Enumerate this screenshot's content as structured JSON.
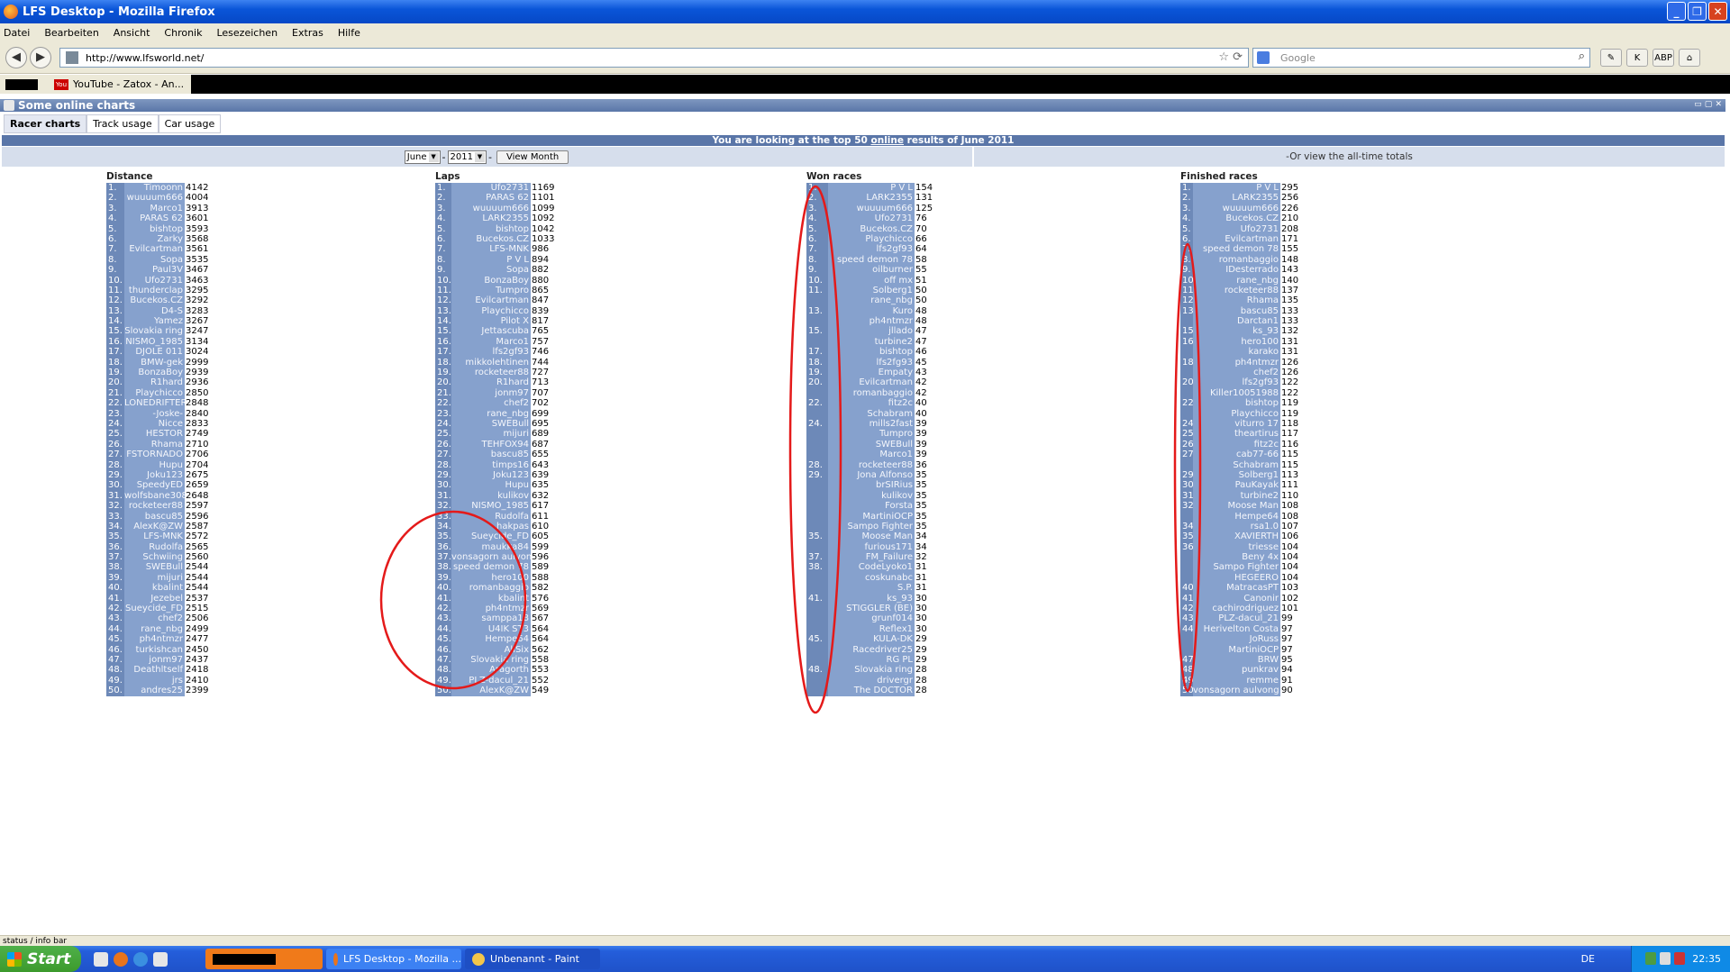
{
  "window": {
    "title": "LFS Desktop - Mozilla Firefox",
    "buttons": [
      "_",
      "❐",
      "✕"
    ]
  },
  "menu": [
    "Datei",
    "Bearbeiten",
    "Ansicht",
    "Chronik",
    "Lesezeichen",
    "Extras",
    "Hilfe"
  ],
  "nav": {
    "url": "http://www.lfsworld.net/",
    "search_placeholder": "Google"
  },
  "bookmarks": {
    "youtube": "YouTube - Zatox - An...",
    "yt_icon": "You"
  },
  "panel": {
    "title": "Some online charts"
  },
  "tabs": [
    "Racer charts",
    "Track usage",
    "Car usage"
  ],
  "banner": {
    "pre": "You are looking at the top 50 ",
    "link": "online",
    "post": " results of June 2011"
  },
  "controls": {
    "month": "June",
    "year": "2011",
    "sep": "-",
    "view_button": "View Month",
    "alltime": "-Or view the all-time totals"
  },
  "columns": [
    {
      "title": "Distance",
      "rows": [
        [
          "1.",
          "Timoonn",
          "4142"
        ],
        [
          "2.",
          "wuuuum666",
          "4004"
        ],
        [
          "3.",
          "Marco1",
          "3913"
        ],
        [
          "4.",
          "PARAS 62",
          "3601"
        ],
        [
          "5.",
          "bishtop",
          "3593"
        ],
        [
          "6.",
          "Zarky",
          "3568"
        ],
        [
          "7.",
          "Evilcartman",
          "3561"
        ],
        [
          "8.",
          "Sopa",
          "3535"
        ],
        [
          "9.",
          "Paul3V",
          "3467"
        ],
        [
          "10.",
          "Ufo2731",
          "3463"
        ],
        [
          "11.",
          "thunderclap",
          "3295"
        ],
        [
          "12.",
          "Bucekos.CZ",
          "3292"
        ],
        [
          "13.",
          "D4-S",
          "3283"
        ],
        [
          "14.",
          "Yamez",
          "3267"
        ],
        [
          "15.",
          "Slovakia ring",
          "3247"
        ],
        [
          "16.",
          "NISMO_1985",
          "3134"
        ],
        [
          "17.",
          "DJOLE 011",
          "3024"
        ],
        [
          "18.",
          "BMW-gek",
          "2999"
        ],
        [
          "19.",
          "BonzaBoy",
          "2939"
        ],
        [
          "20.",
          "R1hard",
          "2936"
        ],
        [
          "21.",
          "Playchicco",
          "2850"
        ],
        [
          "22.",
          "LONEDRIFTER",
          "2848"
        ],
        [
          "23.",
          "-Joske-",
          "2840"
        ],
        [
          "24.",
          "Nicce",
          "2833"
        ],
        [
          "25.",
          "HESTOR",
          "2749"
        ],
        [
          "26.",
          "Rhama",
          "2710"
        ],
        [
          "27.",
          "FSTORNADO",
          "2706"
        ],
        [
          "28.",
          "Hupu",
          "2704"
        ],
        [
          "29.",
          "Joku123",
          "2675"
        ],
        [
          "30.",
          "SpeedyED",
          "2659"
        ],
        [
          "31.",
          "wolfsbane3088",
          "2648"
        ],
        [
          "32.",
          "rocketeer88",
          "2597"
        ],
        [
          "33.",
          "bascu85",
          "2596"
        ],
        [
          "34.",
          "AlexK@ZW",
          "2587"
        ],
        [
          "35.",
          "LFS-MNK",
          "2572"
        ],
        [
          "36.",
          "Rudolfa",
          "2565"
        ],
        [
          "37.",
          "Schwiing",
          "2560"
        ],
        [
          "38.",
          "SWEBull",
          "2544"
        ],
        [
          "39.",
          "mijuri",
          "2544"
        ],
        [
          "40.",
          "kbalint",
          "2544"
        ],
        [
          "41.",
          "Jezebel",
          "2537"
        ],
        [
          "42.",
          "Sueycide_FD",
          "2515"
        ],
        [
          "43.",
          "chef2",
          "2506"
        ],
        [
          "44.",
          "rane_nbg",
          "2499"
        ],
        [
          "45.",
          "ph4ntmzr",
          "2477"
        ],
        [
          "46.",
          "turkishcan",
          "2450"
        ],
        [
          "47.",
          "jonm97",
          "2437"
        ],
        [
          "48.",
          "Deathltself",
          "2418"
        ],
        [
          "49.",
          "jrs",
          "2410"
        ],
        [
          "50.",
          "andres25",
          "2399"
        ]
      ]
    },
    {
      "title": "Laps",
      "rows": [
        [
          "1.",
          "Ufo2731",
          "1169"
        ],
        [
          "2.",
          "PARAS 62",
          "1101"
        ],
        [
          "3.",
          "wuuuum666",
          "1099"
        ],
        [
          "4.",
          "LARK2355",
          "1092"
        ],
        [
          "5.",
          "bishtop",
          "1042"
        ],
        [
          "6.",
          "Bucekos.CZ",
          "1033"
        ],
        [
          "7.",
          "LFS-MNK",
          "986"
        ],
        [
          "8.",
          "P V L",
          "894"
        ],
        [
          "9.",
          "Sopa",
          "882"
        ],
        [
          "10.",
          "BonzaBoy",
          "880"
        ],
        [
          "11.",
          "Tumpro",
          "865"
        ],
        [
          "12.",
          "Evilcartman",
          "847"
        ],
        [
          "13.",
          "Playchicco",
          "839"
        ],
        [
          "14.",
          "Pilot X",
          "817"
        ],
        [
          "15.",
          "Jettascuba",
          "765"
        ],
        [
          "16.",
          "Marco1",
          "757"
        ],
        [
          "17.",
          "lfs2gf93",
          "746"
        ],
        [
          "18.",
          "mikkolehtinen",
          "744"
        ],
        [
          "19.",
          "rocketeer88",
          "727"
        ],
        [
          "20.",
          "R1hard",
          "713"
        ],
        [
          "21.",
          "jonm97",
          "707"
        ],
        [
          "22.",
          "chef2",
          "702"
        ],
        [
          "23.",
          "rane_nbg",
          "699"
        ],
        [
          "24.",
          "SWEBull",
          "695"
        ],
        [
          "25.",
          "mijuri",
          "689"
        ],
        [
          "26.",
          "TEHFOX94",
          "687"
        ],
        [
          "27.",
          "bascu85",
          "655"
        ],
        [
          "28.",
          "timps16",
          "643"
        ],
        [
          "29.",
          "Joku123",
          "639"
        ],
        [
          "30.",
          "Hupu",
          "635"
        ],
        [
          "31.",
          "kulikov",
          "632"
        ],
        [
          "32.",
          "NISMO_1985",
          "617"
        ],
        [
          "33.",
          "Rudolfa",
          "611"
        ],
        [
          "34.",
          "hakpas",
          "610"
        ],
        [
          "35.",
          "Sueycide_FD",
          "605"
        ],
        [
          "36.",
          "maukka84",
          "599"
        ],
        [
          "37.",
          "vonsagorn aulvong",
          "596"
        ],
        [
          "38.",
          "speed demon 78",
          "589"
        ],
        [
          "39.",
          "hero100",
          "588"
        ],
        [
          "40.",
          "romanbaggio",
          "582"
        ],
        [
          "41.",
          "kbalint",
          "576"
        ],
        [
          "42.",
          "ph4ntmzr",
          "569"
        ],
        [
          "43.",
          "samppa18",
          "567"
        ],
        [
          "44.",
          "U4IK ST3",
          "564"
        ],
        [
          "45.",
          "Hempe64",
          "564"
        ],
        [
          "46.",
          "AllSix",
          "562"
        ],
        [
          "47.",
          "Slovakia ring",
          "558"
        ],
        [
          "48.",
          "Aragorth",
          "553"
        ],
        [
          "49.",
          "PLZ-dacul_21",
          "552"
        ],
        [
          "50.",
          "AlexK@ZW",
          "549"
        ]
      ]
    },
    {
      "title": "Won races",
      "rows": [
        [
          "1.",
          "P V L",
          "154"
        ],
        [
          "2.",
          "LARK2355",
          "131"
        ],
        [
          "3.",
          "wuuuum666",
          "125"
        ],
        [
          "4.",
          "Ufo2731",
          "76"
        ],
        [
          "5.",
          "Bucekos.CZ",
          "70"
        ],
        [
          "6.",
          "Playchicco",
          "66"
        ],
        [
          "7.",
          "lfs2gf93",
          "64"
        ],
        [
          "8.",
          "speed demon 78",
          "58"
        ],
        [
          "9.",
          "oilburner",
          "55"
        ],
        [
          "10.",
          "off mx",
          "51"
        ],
        [
          "11.",
          "Solberg1",
          "50"
        ],
        [
          "",
          "rane_nbg",
          "50"
        ],
        [
          "13.",
          "Kuro",
          "48"
        ],
        [
          "",
          "ph4ntmzr",
          "48"
        ],
        [
          "15.",
          "jllado",
          "47"
        ],
        [
          "",
          "turbine2",
          "47"
        ],
        [
          "17.",
          "bishtop",
          "46"
        ],
        [
          "18.",
          "lfs2fg93",
          "45"
        ],
        [
          "19.",
          "Empaty",
          "43"
        ],
        [
          "20.",
          "Evilcartman",
          "42"
        ],
        [
          "",
          "romanbaggio",
          "42"
        ],
        [
          "22.",
          "fitz2c",
          "40"
        ],
        [
          "",
          "Schabram",
          "40"
        ],
        [
          "24.",
          "mills2fast",
          "39"
        ],
        [
          "",
          "Tumpro",
          "39"
        ],
        [
          "",
          "SWEBull",
          "39"
        ],
        [
          "",
          "Marco1",
          "39"
        ],
        [
          "28.",
          "rocketeer88",
          "36"
        ],
        [
          "29.",
          "Jona Alfonso",
          "35"
        ],
        [
          "",
          "brSIRius",
          "35"
        ],
        [
          "",
          "kulikov",
          "35"
        ],
        [
          "",
          "Forsta",
          "35"
        ],
        [
          "",
          "MartiniOCP",
          "35"
        ],
        [
          "",
          "Sampo Fighter",
          "35"
        ],
        [
          "35.",
          "Moose Man",
          "34"
        ],
        [
          "",
          "furious171",
          "34"
        ],
        [
          "37.",
          "FM_Failure",
          "32"
        ],
        [
          "38.",
          "CodeLyoko1",
          "31"
        ],
        [
          "",
          "coskunabc",
          "31"
        ],
        [
          "",
          "S.P.",
          "31"
        ],
        [
          "41.",
          "ks_93",
          "30"
        ],
        [
          "",
          "STIGGLER (BE)",
          "30"
        ],
        [
          "",
          "grunf014",
          "30"
        ],
        [
          "",
          "Reflex1",
          "30"
        ],
        [
          "45.",
          "KULA-DK",
          "29"
        ],
        [
          "",
          "Racedriver25",
          "29"
        ],
        [
          "",
          "RG PL",
          "29"
        ],
        [
          "48.",
          "Slovakia ring",
          "28"
        ],
        [
          "",
          "drivergr",
          "28"
        ],
        [
          "",
          "The DOCTOR",
          "28"
        ]
      ]
    },
    {
      "title": "Finished races",
      "rows": [
        [
          "1.",
          "P V L",
          "295"
        ],
        [
          "2.",
          "LARK2355",
          "256"
        ],
        [
          "3.",
          "wuuuum666",
          "226"
        ],
        [
          "4.",
          "Bucekos.CZ",
          "210"
        ],
        [
          "5.",
          "Ufo2731",
          "208"
        ],
        [
          "6.",
          "Evilcartman",
          "171"
        ],
        [
          "7.",
          "speed demon 78",
          "155"
        ],
        [
          "8.",
          "romanbaggio",
          "148"
        ],
        [
          "9.",
          "IDesterrado",
          "143"
        ],
        [
          "10.",
          "rane_nbg",
          "140"
        ],
        [
          "11.",
          "rocketeer88",
          "137"
        ],
        [
          "12.",
          "Rhama",
          "135"
        ],
        [
          "13.",
          "bascu85",
          "133"
        ],
        [
          "",
          "Darctan1",
          "133"
        ],
        [
          "15.",
          "ks_93",
          "132"
        ],
        [
          "16.",
          "hero100",
          "131"
        ],
        [
          "",
          "karako",
          "131"
        ],
        [
          "18.",
          "ph4ntmzr",
          "126"
        ],
        [
          "",
          "chef2",
          "126"
        ],
        [
          "20.",
          "lfs2gf93",
          "122"
        ],
        [
          "",
          "Killer10051988",
          "122"
        ],
        [
          "22.",
          "bishtop",
          "119"
        ],
        [
          "",
          "Playchicco",
          "119"
        ],
        [
          "24.",
          "viturro 17",
          "118"
        ],
        [
          "25.",
          "theartirus",
          "117"
        ],
        [
          "26.",
          "fitz2c",
          "116"
        ],
        [
          "27.",
          "cab77-66",
          "115"
        ],
        [
          "",
          "Schabram",
          "115"
        ],
        [
          "29.",
          "Solberg1",
          "113"
        ],
        [
          "30.",
          "PauKayak",
          "111"
        ],
        [
          "31.",
          "turbine2",
          "110"
        ],
        [
          "32.",
          "Moose Man",
          "108"
        ],
        [
          "",
          "Hempe64",
          "108"
        ],
        [
          "34.",
          "rsa1.0",
          "107"
        ],
        [
          "35.",
          "XAVIERTH",
          "106"
        ],
        [
          "36.",
          "triesse",
          "104"
        ],
        [
          "",
          "Beny 4x",
          "104"
        ],
        [
          "",
          "Sampo Fighter",
          "104"
        ],
        [
          "",
          "HEGEERO",
          "104"
        ],
        [
          "40.",
          "MatracasPT",
          "103"
        ],
        [
          "41.",
          "Canonir",
          "102"
        ],
        [
          "42.",
          "cachirodriguez",
          "101"
        ],
        [
          "43.",
          "PLZ-dacul_21",
          "99"
        ],
        [
          "44.",
          "Herivelton Costa",
          "97"
        ],
        [
          "",
          "JoRuss",
          "97"
        ],
        [
          "",
          "MartiniOCP",
          "97"
        ],
        [
          "47.",
          "BRW",
          "95"
        ],
        [
          "48.",
          "punkrav",
          "94"
        ],
        [
          "49.",
          "remme",
          "91"
        ],
        [
          "50.",
          "vonsagorn aulvong",
          "90"
        ]
      ]
    }
  ],
  "status": "status / info bar",
  "taskbar": {
    "start": "Start",
    "tasks": [
      "LFS Desktop - Mozilla ...",
      "Unbenannt - Paint"
    ],
    "lang": "DE",
    "clock": "22:35"
  }
}
